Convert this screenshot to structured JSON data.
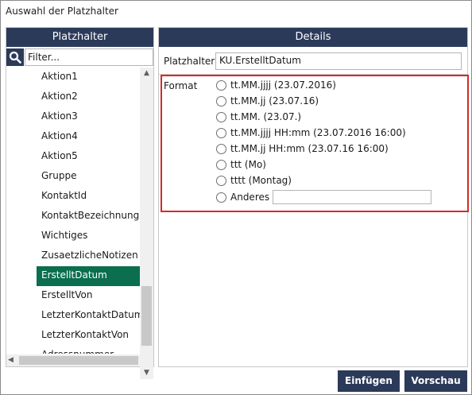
{
  "window": {
    "title": "Auswahl der Platzhalter"
  },
  "left": {
    "header": "Platzhalter",
    "search": {
      "placeholder": "Filter..."
    },
    "items": [
      {
        "label": "Aktion1"
      },
      {
        "label": "Aktion2"
      },
      {
        "label": "Aktion3"
      },
      {
        "label": "Aktion4"
      },
      {
        "label": "Aktion5"
      },
      {
        "label": "Gruppe"
      },
      {
        "label": "KontaktId"
      },
      {
        "label": "KontaktBezeichnung"
      },
      {
        "label": "Wichtiges"
      },
      {
        "label": "ZusaetzlicheNotizen"
      },
      {
        "label": "ErstelltDatum"
      },
      {
        "label": "ErstelltVon"
      },
      {
        "label": "LetzterKontaktDatum"
      },
      {
        "label": "LetzterKontaktVon"
      },
      {
        "label": "Adressnummer"
      }
    ],
    "selected_item": "ErstelltDatum"
  },
  "right": {
    "header": "Details",
    "placeholder_label": "Platzhalter",
    "placeholder_value": "KU.ErstelltDatum",
    "format_label": "Format",
    "formats": [
      {
        "label": "tt.MM.jjjj (23.07.2016)"
      },
      {
        "label": "tt.MM.jj (23.07.16)"
      },
      {
        "label": "tt.MM. (23.07.)"
      },
      {
        "label": "tt.MM.jjjj HH:mm (23.07.2016 16:00)"
      },
      {
        "label": "tt.MM.jj HH:mm (23.07.16 16:00)"
      },
      {
        "label": "ttt (Mo)"
      },
      {
        "label": "tttt (Montag)"
      },
      {
        "label": "Anderes"
      }
    ],
    "other_value": ""
  },
  "buttons": {
    "insert": "Einfügen",
    "preview": "Vorschau"
  },
  "colors": {
    "header_bg": "#2c3a5a",
    "selected_bg": "#0b6e4f",
    "highlight_border": "#d42a2a"
  }
}
